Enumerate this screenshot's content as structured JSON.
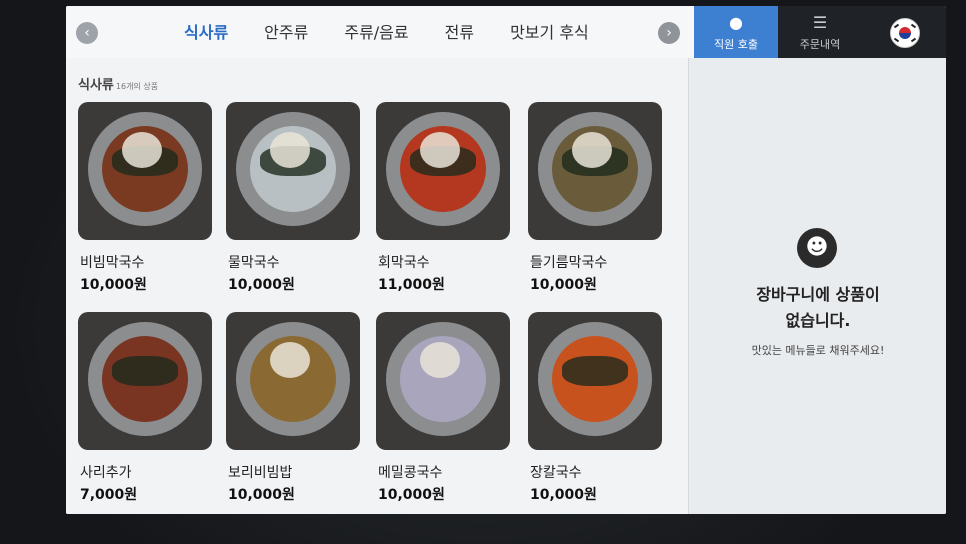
{
  "header": {
    "tabs": [
      {
        "label": "식사류",
        "active": true
      },
      {
        "label": "안주류",
        "active": false
      },
      {
        "label": "주류/음료",
        "active": false
      },
      {
        "label": "전류",
        "active": false
      },
      {
        "label": "맛보기 후식",
        "active": false
      }
    ],
    "staff_call_label": "직원 호출",
    "orders_label": "주문내역",
    "prev_icon": "chevron-left-icon",
    "next_icon": "chevron-right-icon",
    "language_icon": "korea-flag-icon"
  },
  "section": {
    "title": "식사류",
    "count": "16개의 상품"
  },
  "items": [
    {
      "name": "비빔막국수",
      "price": "10,000원",
      "food_color": "#7a3a22"
    },
    {
      "name": "물막국수",
      "price": "10,000원",
      "food_color": "#b9c0c4"
    },
    {
      "name": "회막국수",
      "price": "11,000원",
      "food_color": "#b4381f"
    },
    {
      "name": "들기름막국수",
      "price": "10,000원",
      "food_color": "#6a5b3a"
    },
    {
      "name": "사리추가",
      "price": "7,000원",
      "food_color": "#7a3422"
    },
    {
      "name": "보리비빔밥",
      "price": "10,000원",
      "food_color": "#8a6a32"
    },
    {
      "name": "메밀콩국수",
      "price": "10,000원",
      "food_color": "#a9a5bd"
    },
    {
      "name": "장칼국수",
      "price": "10,000원",
      "food_color": "#c8521e"
    }
  ],
  "cart": {
    "empty_line1": "장바구니에 상품이",
    "empty_line2": "없습니다.",
    "subtext": "맛있는 메뉴들로 채워주세요!"
  },
  "colors": {
    "accent": "#3d7fd1",
    "active_tab": "#2b6cc4"
  }
}
